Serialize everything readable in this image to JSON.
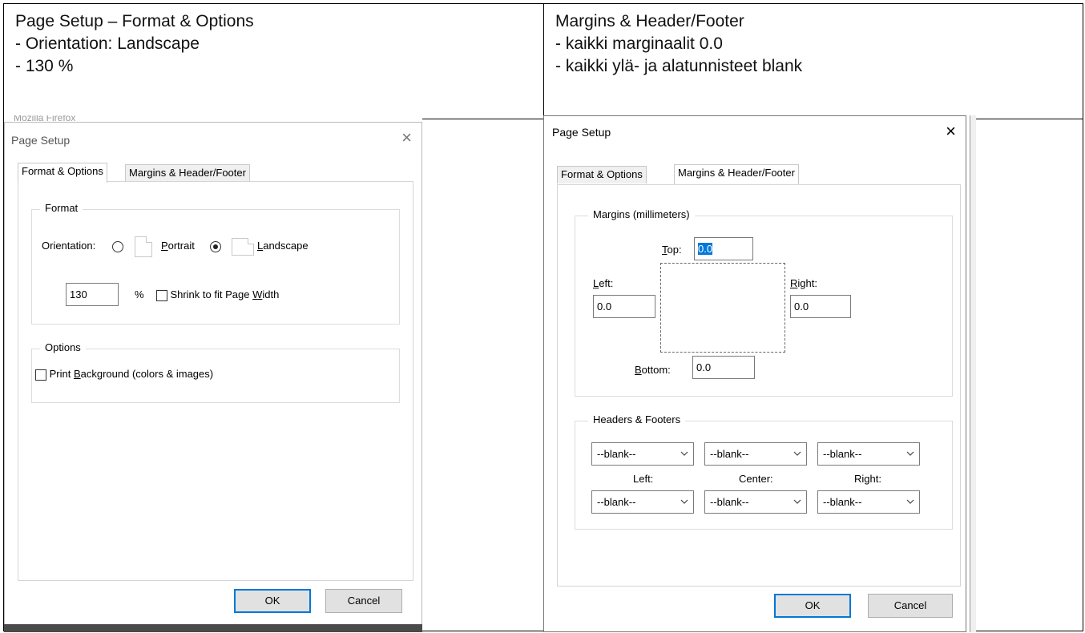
{
  "captions": {
    "left": {
      "heading": "Page Setup – Format & Options",
      "line1": "- Orientation: Landscape",
      "line2": "- 130 %"
    },
    "right": {
      "heading": "Margins & Header/Footer",
      "line1": "- kaikki marginaalit 0.0",
      "line2": "- kaikki ylä- ja alatunnisteet blank"
    }
  },
  "background_window_title": "Mozilla Firefox",
  "dialog": {
    "title": "Page Setup",
    "close": "×",
    "tabs": [
      "Format & Options",
      "Margins & Header/Footer"
    ],
    "ok": "OK",
    "cancel": "Cancel"
  },
  "format_tab": {
    "format_legend": "Format",
    "orientation_label": "Orientation:",
    "portrait_label": "ortrait",
    "portrait_mnemonic": "P",
    "landscape_label": "andscape",
    "landscape_mnemonic": "L",
    "orientation_selected": "Landscape",
    "scale_value": "130",
    "percent_sign": "%",
    "shrink_label_pre": "Shrink to fit Page ",
    "shrink_mnemonic": "W",
    "shrink_label_post": "idth",
    "shrink_checked": false,
    "options_legend": "Options",
    "print_bg_pre": "Print ",
    "print_bg_mnemonic": "B",
    "print_bg_post": "ackground (colors & images)",
    "print_bg_checked": false
  },
  "margins_tab": {
    "margins_legend": "Margins (millimeters)",
    "top_mnemonic": "T",
    "top_label": "op:",
    "top_value": "0.0",
    "left_mnemonic": "L",
    "left_label": "eft:",
    "left_value": "0.0",
    "right_mnemonic": "R",
    "right_label": "ight:",
    "right_value": "0.0",
    "bottom_mnemonic": "B",
    "bottom_label": "ottom:",
    "bottom_value": "0.0",
    "hf_legend": "Headers & Footers",
    "header_values": [
      "--blank--",
      "--blank--",
      "--blank--"
    ],
    "footer_values": [
      "--blank--",
      "--blank--",
      "--blank--"
    ],
    "col_labels": [
      "Left:",
      "Center:",
      "Right:"
    ]
  },
  "colors": {
    "selection_blue": "#0078d7",
    "button_face": "#e1e1e1"
  }
}
